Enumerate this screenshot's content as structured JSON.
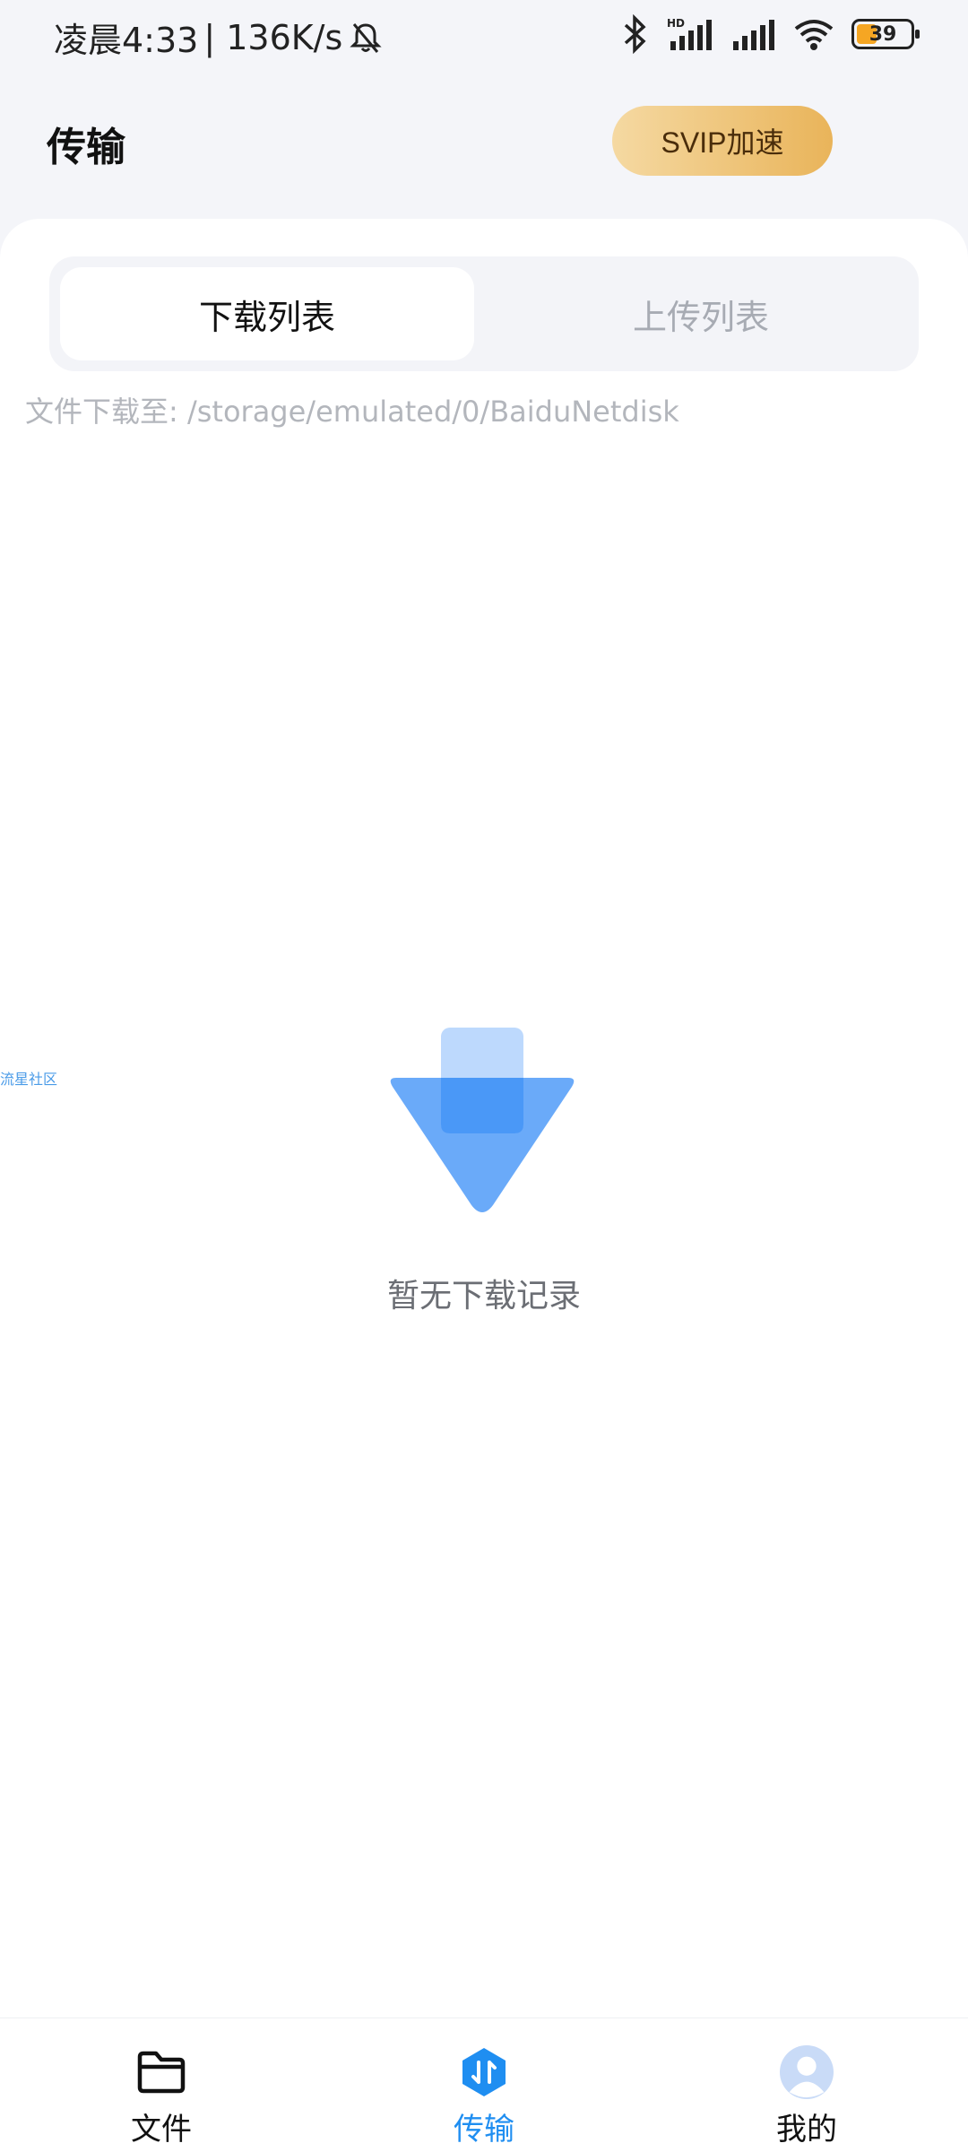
{
  "status_bar": {
    "time": "凌晨4:33",
    "network_speed": "| 136K/s",
    "battery_level": "39"
  },
  "header": {
    "title": "传输",
    "svip_button": "SVIP加速"
  },
  "tabs": {
    "download_list": "下载列表",
    "upload_list": "上传列表"
  },
  "download_path": "文件下载至: /storage/emulated/0/BaiduNetdisk",
  "watermark": "流星社区",
  "empty_state": {
    "text": "暂无下载记录"
  },
  "bottom_nav": {
    "files": "文件",
    "transfer": "传输",
    "mine": "我的"
  },
  "colors": {
    "accent_blue": "#1f8ef1",
    "svip_gold": "#e9b45a",
    "page_bg": "#f4f5f9"
  }
}
